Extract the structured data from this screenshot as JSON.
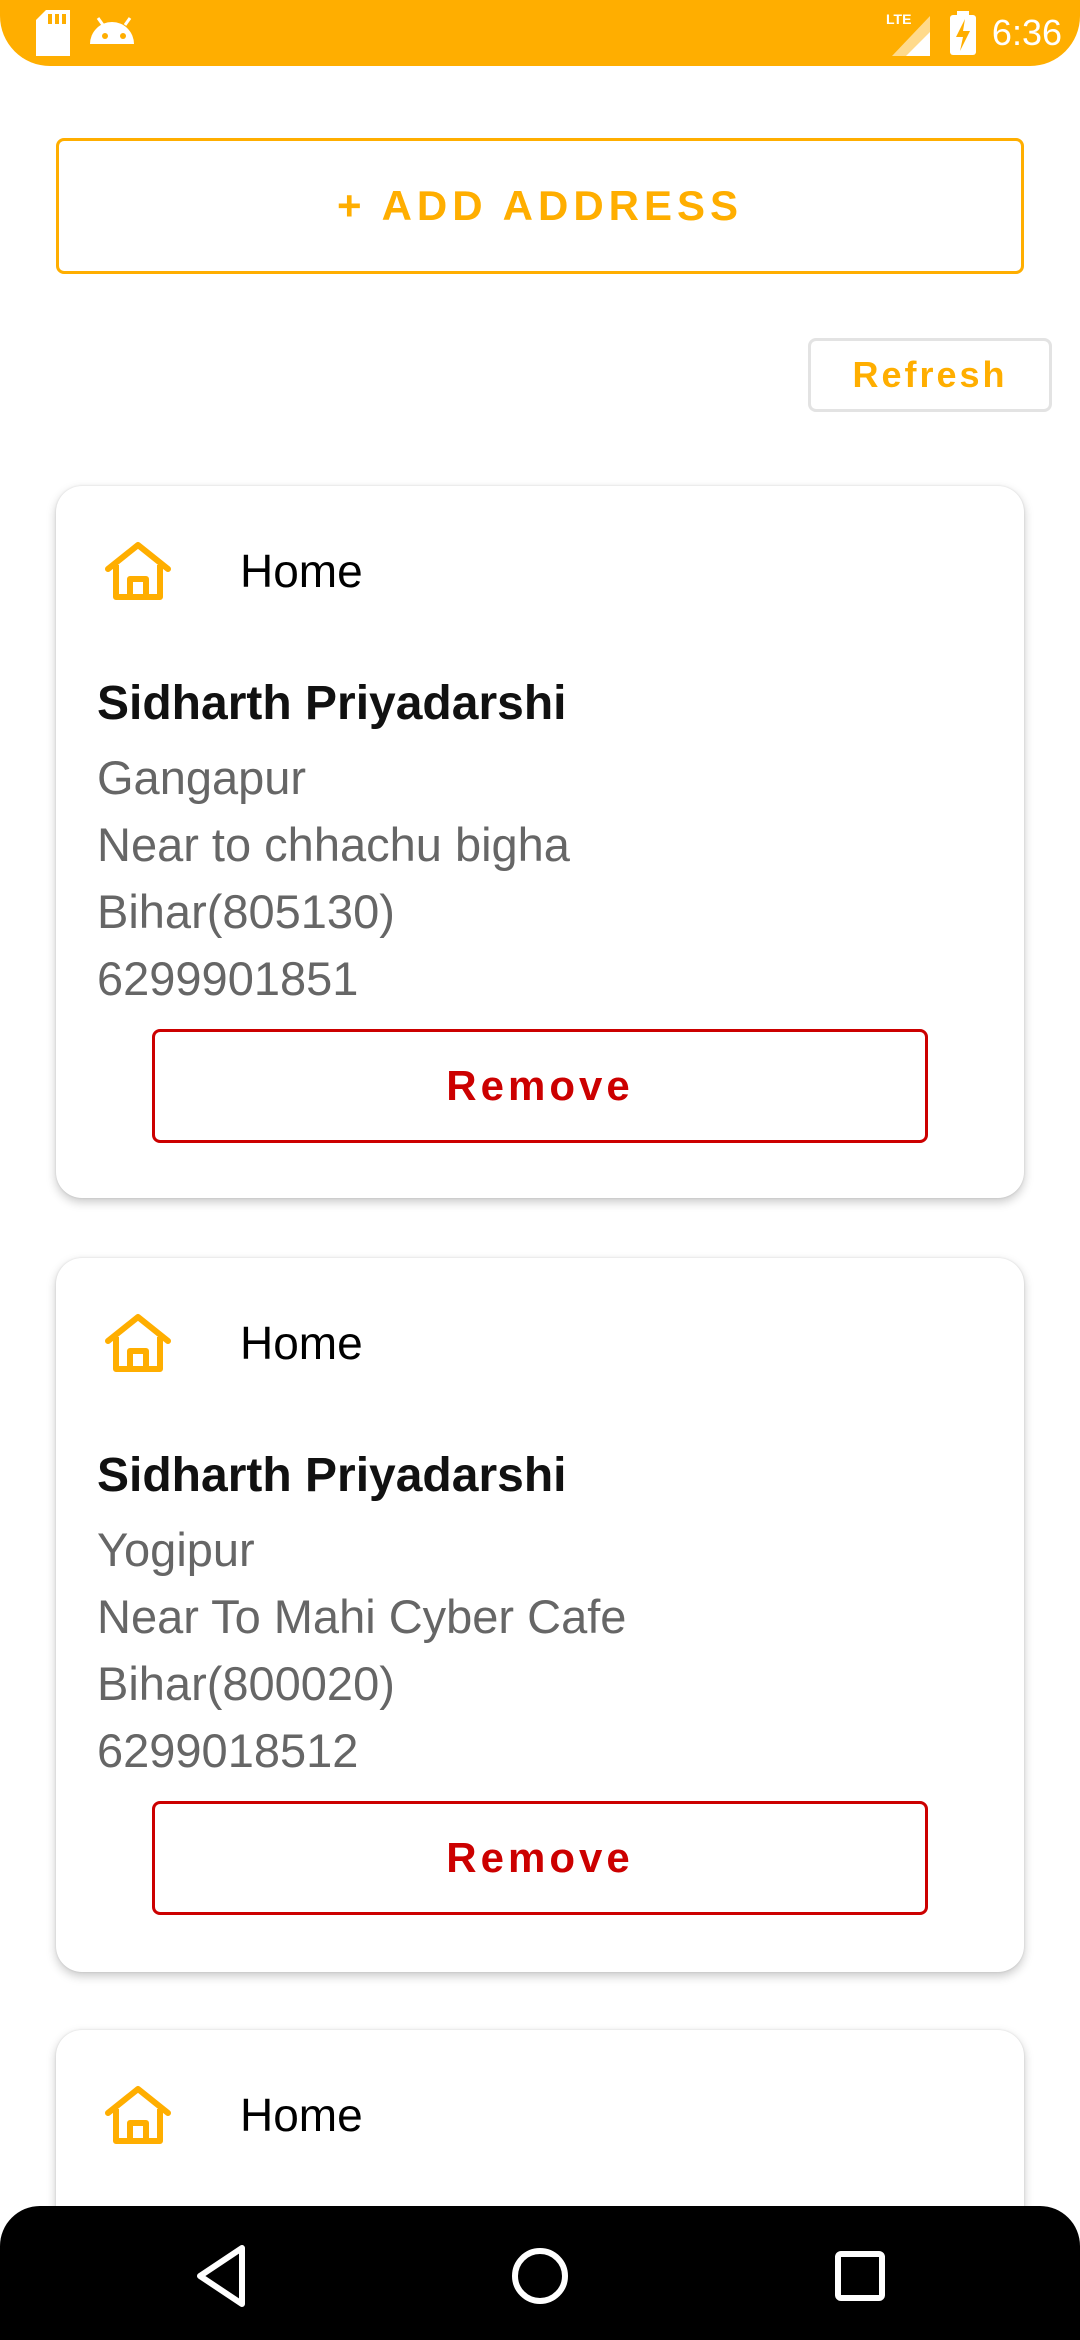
{
  "status_bar": {
    "time": "6:36",
    "network": "LTE",
    "icons": [
      "sd-card-icon",
      "android-icon",
      "lte-signal-icon",
      "battery-charging-icon"
    ],
    "color": "#FFAE00"
  },
  "actions": {
    "add_address_label": "+ ADD ADDRESS",
    "refresh_label": "Refresh"
  },
  "addresses": [
    {
      "type": "Home",
      "name": "Sidharth Priyadarshi",
      "locality": "Gangapur",
      "landmark": "Near to chhachu bigha",
      "state_pin": "Bihar(805130)",
      "phone": "6299901851",
      "remove_label": "Remove"
    },
    {
      "type": "Home",
      "name": "Sidharth Priyadarshi",
      "locality": "Yogipur",
      "landmark": "Near To Mahi Cyber Cafe",
      "state_pin": "Bihar(800020)",
      "phone": "6299018512",
      "remove_label": "Remove"
    },
    {
      "type": "Home"
    }
  ],
  "colors": {
    "accent": "#FFAE00",
    "danger": "#CC0000",
    "secondary_text": "#666666"
  },
  "nav_bar": {
    "icons": [
      "back-icon",
      "home-circle-icon",
      "recents-icon"
    ]
  }
}
